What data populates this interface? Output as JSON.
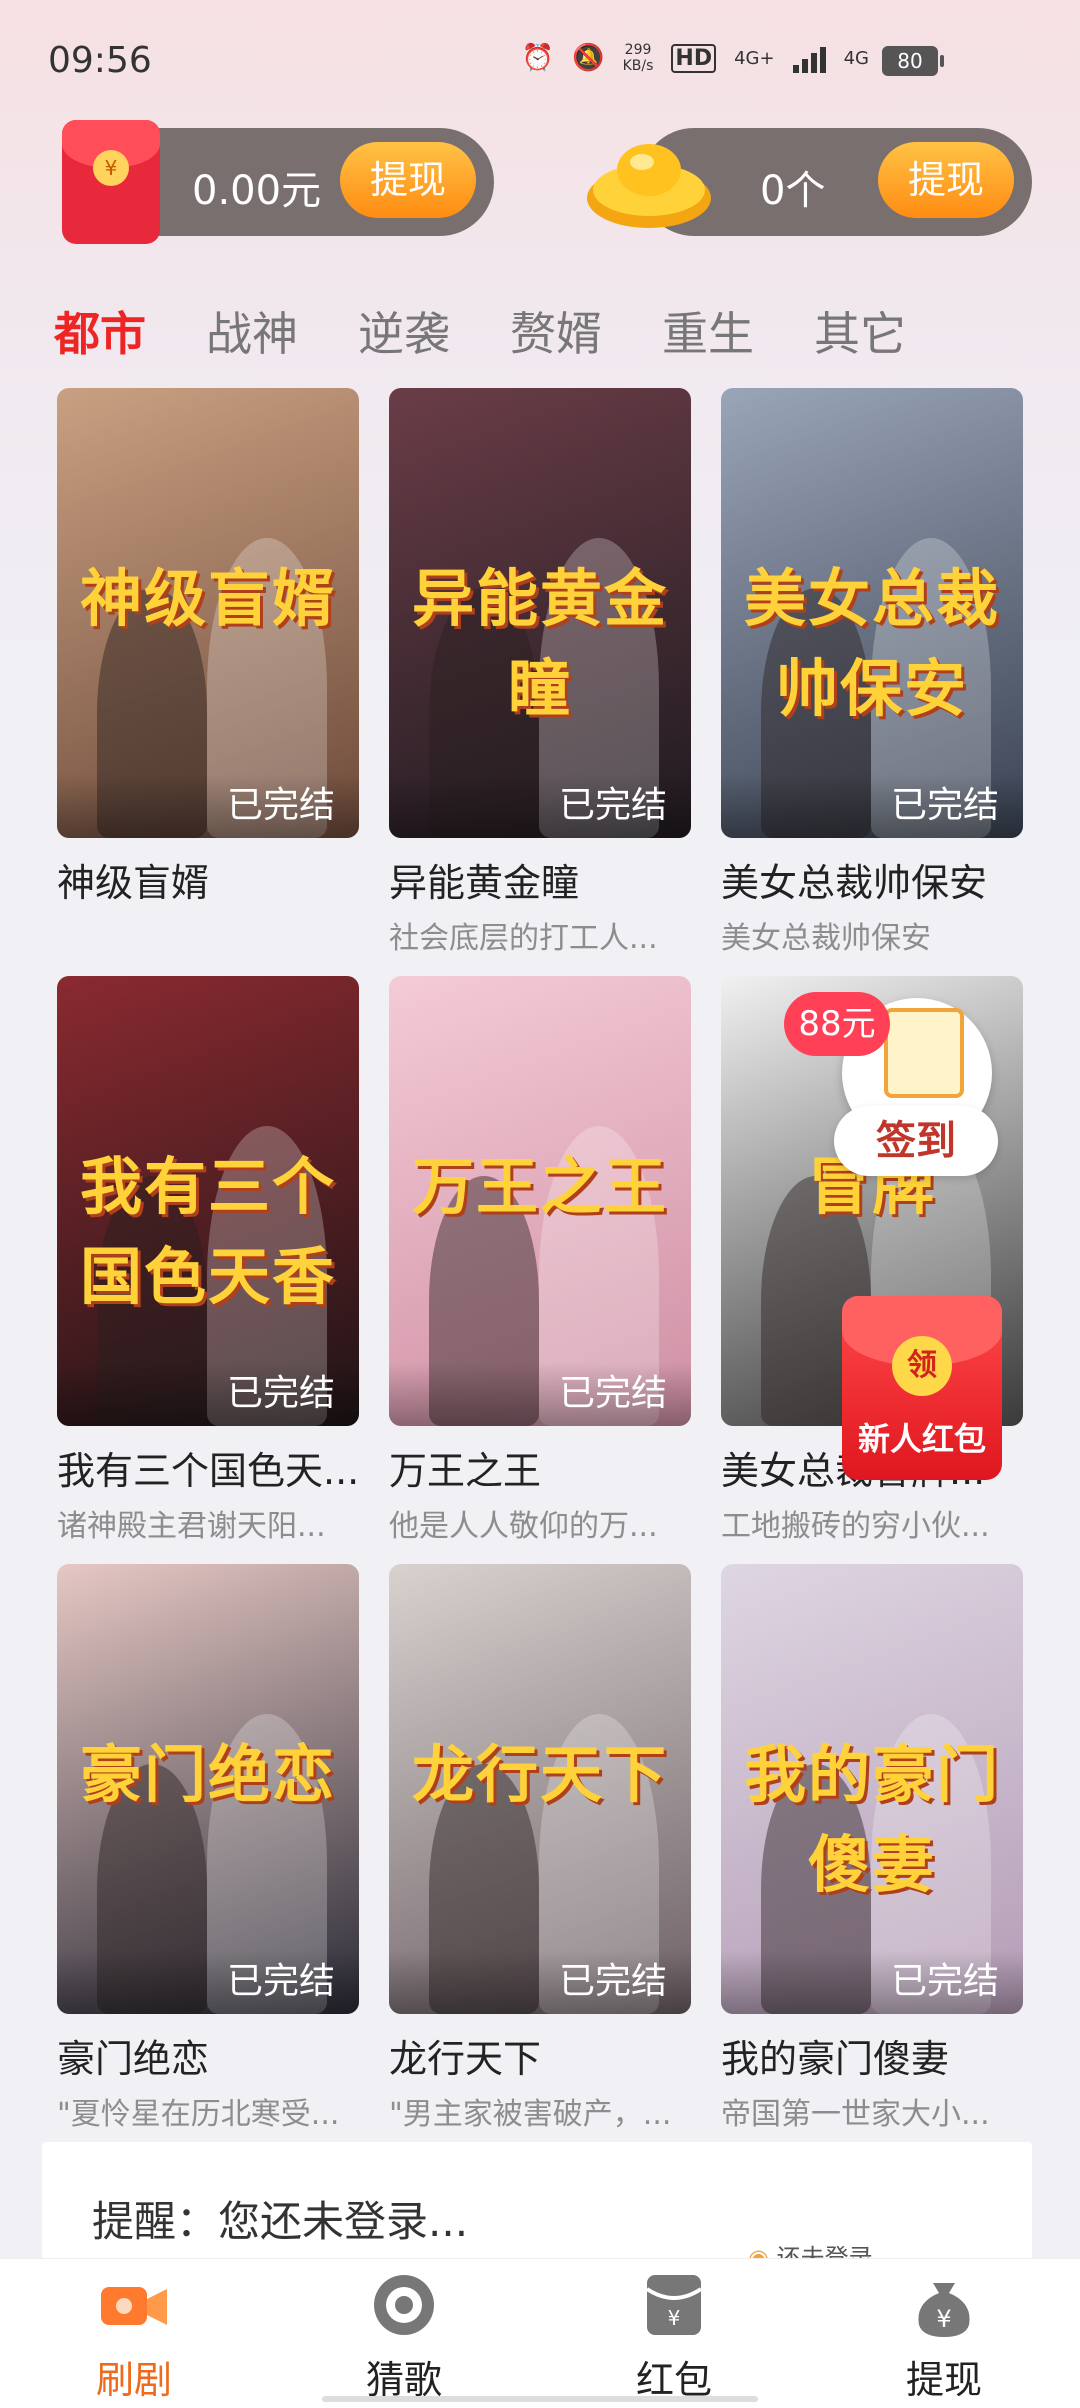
{
  "status_bar": {
    "time": "09:56",
    "net_speed_value": "299",
    "net_speed_unit": "KB/s",
    "hd_label": "HD",
    "sig1": "4G+",
    "sig2": "4G",
    "battery": "80"
  },
  "wallet": {
    "cash_amount": "0.00元",
    "cash_withdraw": "提现",
    "gold_amount": "0个",
    "gold_withdraw": "提现",
    "redpacket_symbol": "¥"
  },
  "tabs": [
    "都市",
    "战神",
    "逆袭",
    "赘婿",
    "重生",
    "其它"
  ],
  "cards": [
    {
      "title": "神级盲婿",
      "desc": "",
      "status": "已完结",
      "poster_text": "神级盲婿",
      "colors": [
        "#c9a081",
        "#6d4a3a"
      ]
    },
    {
      "title": "异能黄金瞳",
      "desc": "社会底层的打工人...",
      "status": "已完结",
      "poster_text": "异能黄金瞳",
      "colors": [
        "#6a3d47",
        "#1f1a20"
      ]
    },
    {
      "title": "美女总裁帅保安",
      "desc": "美女总裁帅保安",
      "status": "已完结",
      "poster_text": "美女总裁 帅保安",
      "colors": [
        "#9aa5b8",
        "#3a4252"
      ]
    },
    {
      "title": "我有三个国色天...",
      "desc": "诸神殿主君谢天阳...",
      "status": "已完结",
      "poster_text": "我有三个国色天香",
      "colors": [
        "#8a2a30",
        "#1e1416"
      ]
    },
    {
      "title": "万王之王",
      "desc": "他是人人敬仰的万...",
      "status": "已完结",
      "poster_text": "万王之王",
      "colors": [
        "#f4cbd6",
        "#cf8fa4"
      ]
    },
    {
      "title": "美女总裁冒牌...",
      "desc": "工地搬砖的穷小伙...",
      "status": "",
      "poster_text": "冒牌",
      "colors": [
        "#f1f1f1",
        "#3a3a3a"
      ]
    },
    {
      "title": "豪门绝恋",
      "desc": "\"夏怜星在历北寒受...",
      "status": "已完结",
      "poster_text": "豪门绝恋",
      "colors": [
        "#e6c8c4",
        "#2b2b36"
      ]
    },
    {
      "title": "龙行天下",
      "desc": "\"男主家被害破产，...",
      "status": "已完结",
      "poster_text": "龙行天下",
      "colors": [
        "#d8d2cf",
        "#6d6066"
      ]
    },
    {
      "title": "我的豪门傻妻",
      "desc": "帝国第一世家大小...",
      "status": "已完结",
      "poster_text": "我的豪门傻妻",
      "colors": [
        "#ded6e2",
        "#b49cb6"
      ]
    }
  ],
  "widgets": {
    "bonus_badge": "88元",
    "signin_label": "签到",
    "newred_symbol": "领",
    "newred_label": "新人红包"
  },
  "reminder": {
    "text": "提醒：您还未登录...",
    "sub": "还未登录"
  },
  "nav": {
    "items": [
      {
        "label": "刷剧",
        "icon": "video-camera-icon",
        "active": true
      },
      {
        "label": "猜歌",
        "icon": "music-disc-icon",
        "active": false
      },
      {
        "label": "红包",
        "icon": "red-envelope-icon",
        "active": false
      },
      {
        "label": "提现",
        "icon": "money-bag-icon",
        "active": false
      }
    ]
  },
  "colors": {
    "accent_red": "#ee2525",
    "accent_orange": "#ee6a1d",
    "withdraw_button": "#ff9a1f"
  }
}
